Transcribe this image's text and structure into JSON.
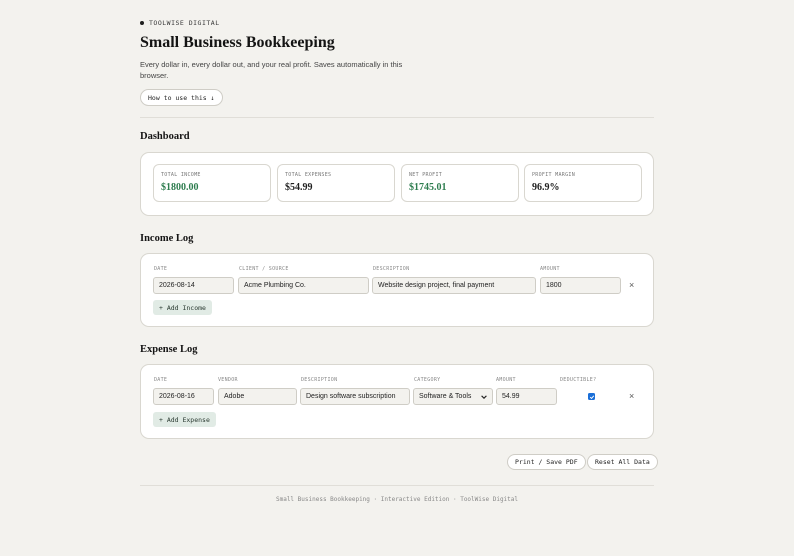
{
  "brand": "TOOLWISE DIGITAL",
  "header": {
    "title": "Small Business Bookkeeping",
    "subtitle": "Every dollar in, every dollar out, and your real profit. Saves automatically in this browser.",
    "how_to_label": "How to use this ↓"
  },
  "dashboard": {
    "title": "Dashboard",
    "stats": [
      {
        "label": "TOTAL INCOME",
        "value": "$1800.00",
        "color": "#2e7d4f"
      },
      {
        "label": "TOTAL EXPENSES",
        "value": "$54.99",
        "color": "#1f1f1f"
      },
      {
        "label": "NET PROFIT",
        "value": "$1745.01",
        "color": "#2e7d4f"
      },
      {
        "label": "PROFIT MARGIN",
        "value": "96.9%",
        "color": "#1f1f1f"
      }
    ]
  },
  "income": {
    "title": "Income Log",
    "columns": [
      "DATE",
      "CLIENT / SOURCE",
      "DESCRIPTION",
      "AMOUNT"
    ],
    "rows": [
      {
        "date": "2026-08-14",
        "client": "Acme Plumbing Co.",
        "description": "Website design project, final payment",
        "amount": "1800"
      }
    ],
    "add_label": "+ Add Income",
    "remove_label": "×"
  },
  "expense": {
    "title": "Expense Log",
    "columns": [
      "DATE",
      "VENDOR",
      "DESCRIPTION",
      "CATEGORY",
      "AMOUNT",
      "DEDUCTIBLE?"
    ],
    "rows": [
      {
        "date": "2026-08-16",
        "vendor": "Adobe",
        "description": "Design software subscription",
        "category": "Software & Tools",
        "amount": "54.99",
        "deductible": true
      }
    ],
    "add_label": "+ Add Expense",
    "remove_label": "×"
  },
  "actions": {
    "print_label": "Print / Save PDF",
    "reset_label": "Reset All Data"
  },
  "footer": "Small Business Bookkeeping · Interactive Edition · ToolWise Digital",
  "colors": {
    "accent_green": "#2e7d4f",
    "checkbox_blue": "#1b6fd8",
    "background": "#f3f2ee"
  }
}
